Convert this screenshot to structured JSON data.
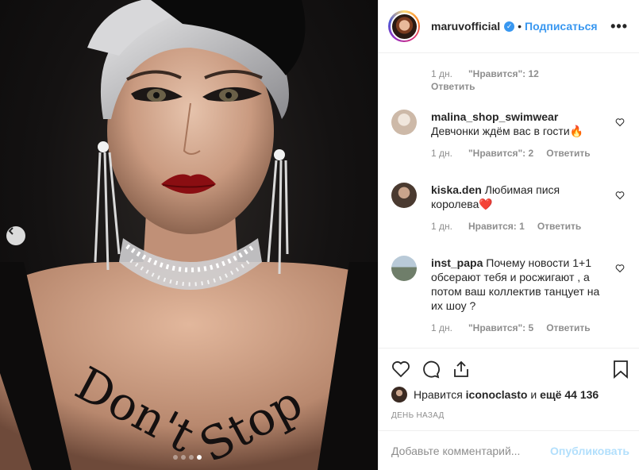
{
  "post": {
    "username": "maruvofficial",
    "follow_label": "Подписаться",
    "separator": "•",
    "more_label": "•••"
  },
  "photo": {
    "body_text": "Don't Stop",
    "carousel": {
      "total": 4,
      "active": 4
    }
  },
  "first_comment": {
    "time": "1 дн.",
    "likes": "\"Нравится\": 12",
    "reply": "Ответить"
  },
  "comments": [
    {
      "username": "malina_shop_swimwear",
      "text": "Девчонки ждём вас в гости🔥",
      "time": "1 дн.",
      "likes": "\"Нравится\": 2",
      "reply": "Ответить",
      "avatar_color": "#cdb9a8"
    },
    {
      "username": "kiska.den",
      "text": "Любимая пися королева❤️",
      "time": "1 дн.",
      "likes": "Нравится: 1",
      "reply": "Ответить",
      "avatar_color": "#5a4a3e"
    },
    {
      "username": "inst_papa",
      "text": "Почему новости 1+1 обсерают тебя и росжигают , а потом ваш коллектив танцует на их шоу ?",
      "time": "1 дн.",
      "likes": "\"Нравится\": 5",
      "reply": "Ответить",
      "avatar_color": "#8fa6b8"
    }
  ],
  "likes_summary": {
    "prefix": "Нравится",
    "user": "iconoclasto",
    "middle": "и",
    "rest": "ещё 44 136"
  },
  "posted_ago": "ДЕНЬ НАЗАД",
  "composer": {
    "placeholder": "Добавьте комментарий...",
    "publish_label": "Опубликовать"
  },
  "colors": {
    "accent": "#3897f0",
    "muted": "#8e8e8e",
    "publish_disabled": "#b2dffc"
  },
  "icons": [
    "chevron-left-icon",
    "verified-icon",
    "heart-icon",
    "comment-icon",
    "share-icon",
    "bookmark-icon",
    "more-icon"
  ]
}
